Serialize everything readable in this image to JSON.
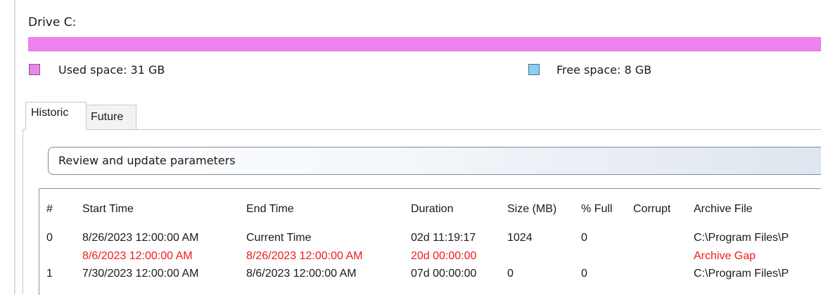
{
  "drive": {
    "label": "Drive C:",
    "used_fraction": 1.0,
    "used_text": "Used space: 31 GB",
    "free_text": "Free space: 8 GB",
    "used_color": "#ee82ee",
    "free_color": "#87cefa"
  },
  "tabs": [
    {
      "label": "Historic",
      "active": true
    },
    {
      "label": "Future",
      "active": false
    }
  ],
  "review_button_label": "Review and update parameters",
  "table": {
    "columns": [
      "#",
      "Start Time",
      "End Time",
      "Duration",
      "Size (MB)",
      "% Full",
      "Corrupt",
      "Archive File"
    ],
    "rows": [
      {
        "num": "0",
        "start": "8/26/2023 12:00:00 AM",
        "end": "Current Time",
        "duration": "02d 11:19:17",
        "size": "1024",
        "full": "0",
        "corrupt": "",
        "file": "C:\\Program Files\\P",
        "status": "normal"
      },
      {
        "num": "",
        "start": "8/6/2023 12:00:00 AM",
        "end": "8/26/2023 12:00:00 AM",
        "duration": "20d 00:00:00",
        "size": "",
        "full": "",
        "corrupt": "",
        "file": "Archive Gap",
        "status": "gap"
      },
      {
        "num": "1",
        "start": "7/30/2023 12:00:00 AM",
        "end": "8/6/2023 12:00:00 AM",
        "duration": "07d 00:00:00",
        "size": "0",
        "full": "0",
        "corrupt": "",
        "file": "C:\\Program Files\\P",
        "status": "normal"
      }
    ],
    "gap_color": "#ee1c1c"
  }
}
